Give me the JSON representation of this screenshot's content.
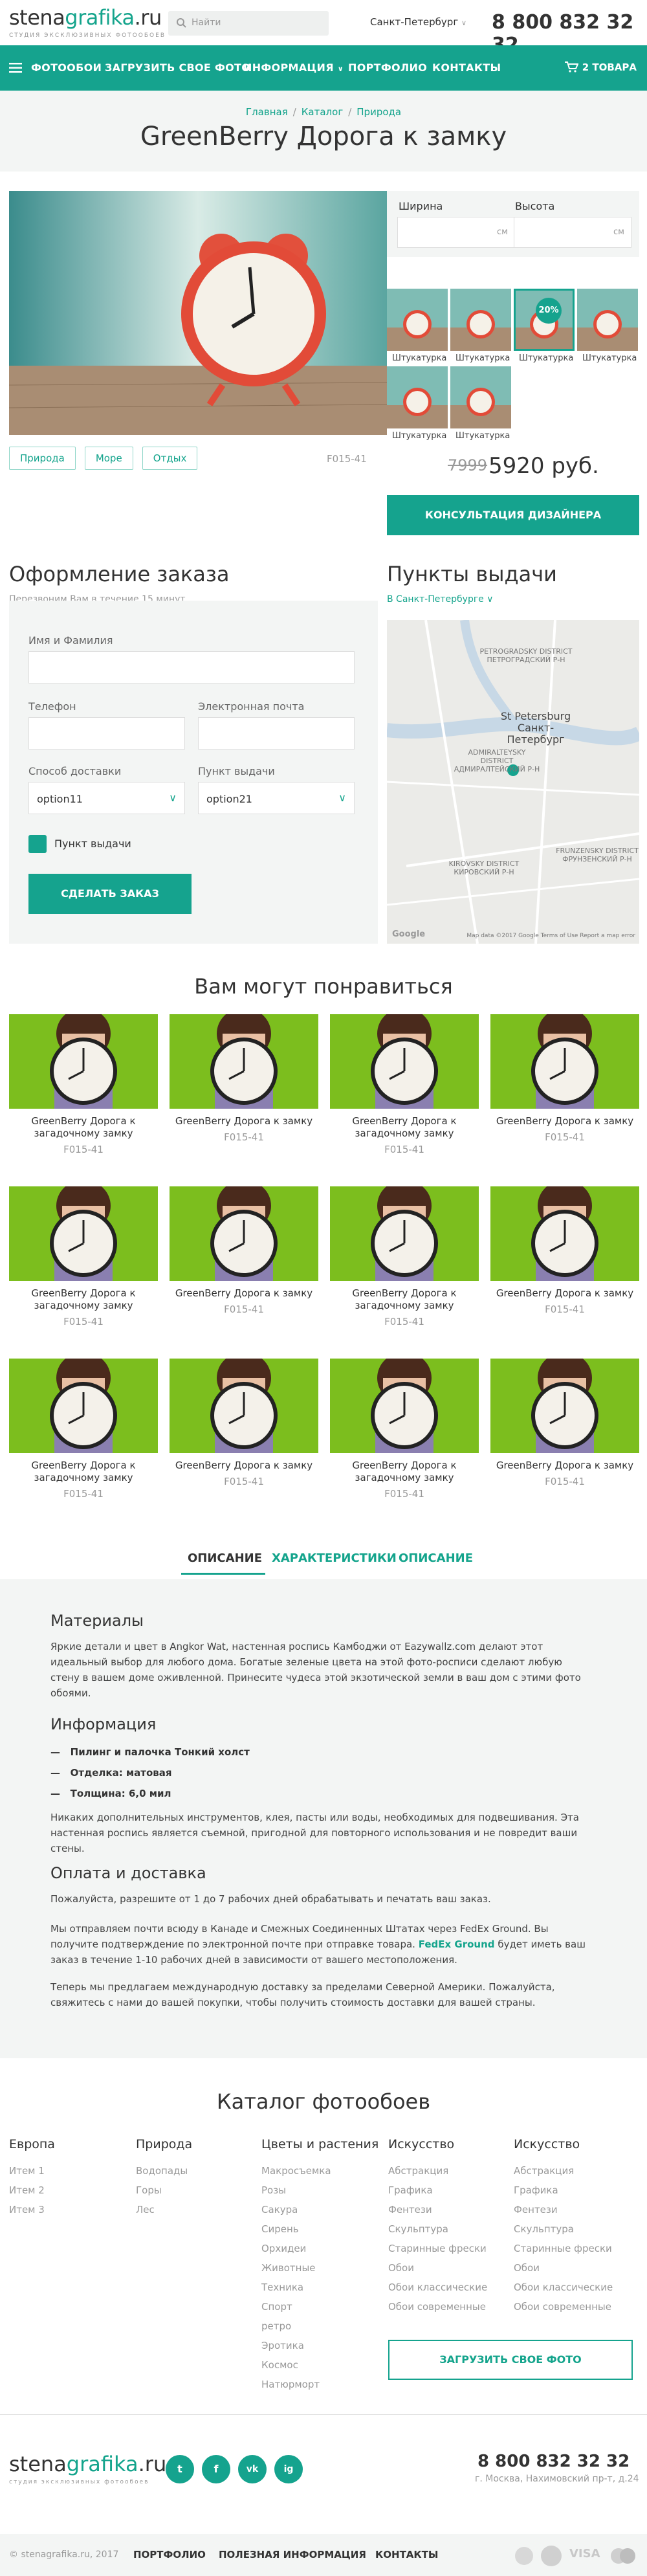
{
  "header": {
    "logo_a": "stena",
    "logo_b": "grafika",
    "logo_c": ".ru",
    "logo_sub": "студия эксклюзивных фотообоев",
    "search_placeholder": "Найти",
    "city": "Санкт-Петербург",
    "phone": "8 800 832 32 32"
  },
  "nav": {
    "items": [
      "ФОТООБОИ",
      "ЗАГРУЗИТЬ СВОЕ ФОТО",
      "ИНФОРМАЦИЯ",
      "ПОРТФОЛИО",
      "КОНТАКТЫ"
    ],
    "cart": "2 ТОВАРА"
  },
  "breadcrumbs": [
    "Главная",
    "Каталог",
    "Природа"
  ],
  "title": "GreenBerry Дорога к замку",
  "product": {
    "tags": [
      "Природа",
      "Море",
      "Отдых"
    ],
    "sku": "F015-41",
    "width_label": "Ширина",
    "height_label": "Высота",
    "unit": "см",
    "swatch_label": "Штукатурка",
    "discount": "20%",
    "old_price": "7999",
    "new_price": "5920 руб.",
    "consult": "КОНСУЛЬТАЦИЯ ДИЗАЙНЕРА"
  },
  "order": {
    "title": "Оформление заказа",
    "subtitle": "Перезвоним Вам в течение 15 минут",
    "name_label": "Имя и Фамилия",
    "phone_label": "Телефон",
    "email_label": "Электронная почта",
    "delivery_label": "Способ доставки",
    "delivery_value": "option11",
    "pickup_label": "Пункт выдачи",
    "pickup_value": "option21",
    "checkbox_label": "Пункт выдачи",
    "submit": "СДЕЛАТЬ ЗАКАЗ"
  },
  "pickup": {
    "title": "Пункты выдачи",
    "city": "В Санкт-Петербурге",
    "map_labels": {
      "petrogradsky": "PETROGRADSKY DISTRICT",
      "petrogradsky_ru": "ПЕТРОГРАДСКИЙ Р-Н",
      "city_en": "St Petersburg",
      "city_ru": "Санкт-Петербург",
      "admiralteysky": "ADMIRALTEYSKY DISTRICT",
      "admiralteysky_ru": "АДМИРАЛТЕЙСКИЙ Р-Н",
      "kirovsky": "KIROVSKY DISTRICT",
      "kirovsky_ru": "КИРОВСКИЙ Р-Н",
      "frunzensky": "FRUNZENSKY DISTRICT",
      "frunzensky_ru": "ФРУНЗЕНСКИЙ Р-Н",
      "google": "Google",
      "attribution": "Map data ©2017 Google   Terms of Use   Report a map error"
    }
  },
  "recommend": {
    "title": "Вам могут понравиться",
    "items": [
      {
        "name": "GreenBerry Дорога к загадочному замку",
        "code": "F015-41"
      },
      {
        "name": "GreenBerry Дорога к замку",
        "code": "F015-41"
      },
      {
        "name": "GreenBerry Дорога к загадочному замку",
        "code": "F015-41"
      },
      {
        "name": "GreenBerry Дорога к замку",
        "code": "F015-41"
      },
      {
        "name": "GreenBerry Дорога к загадочному замку",
        "code": "F015-41"
      },
      {
        "name": "GreenBerry Дорога к замку",
        "code": "F015-41"
      },
      {
        "name": "GreenBerry Дорога к загадочному замку",
        "code": "F015-41"
      },
      {
        "name": "GreenBerry Дорога к замку",
        "code": "F015-41"
      },
      {
        "name": "GreenBerry Дорога к загадочному замку",
        "code": "F015-41"
      },
      {
        "name": "GreenBerry Дорога к замку",
        "code": "F015-41"
      },
      {
        "name": "GreenBerry Дорога к загадочному замку",
        "code": "F015-41"
      },
      {
        "name": "GreenBerry Дорога к замку",
        "code": "F015-41"
      }
    ]
  },
  "tabs": [
    "ОПИСАНИЕ",
    "ХАРАКТЕРИСТИКИ",
    "ОПИСАНИЕ"
  ],
  "description": {
    "materials_title": "Материалы",
    "materials_text": "Яркие детали и цвет в Angkor Wat, настенная роспись Камбоджи от Eazywallz.com делают этот идеальный выбор для любого дома. Богатые зеленые цвета на этой фото-росписи сделают любую стену в вашем доме оживленной. Принесите чудеса этой экзотической земли в ваш дом с этими фото обоями.",
    "info_title": "Информация",
    "info_items": [
      "Пилинг и палочка Тонкий холст",
      "Отделка: матовая",
      "Толщина: 6,0 мил"
    ],
    "info_text": "Никаких дополнительных инструментов, клея, пасты или воды, необходимых для подвешивания. Эта настенная роспись является съемной, пригодной для повторного использования и не повредит ваши стены.",
    "pay_title": "Оплата и доставка",
    "pay_text1": "Пожалуйста, разрешите от 1 до 7 рабочих дней обрабатывать и печатать ваш заказ.",
    "pay_text2a": "Мы отправляем почти всюду в Канаде и Смежных Соединенных Штатах через FedEx Ground. Вы получите подтверждение по электронной почте при отправке товара.",
    "pay_link": "FedEx Ground",
    "pay_text2b": "будет иметь ваш заказ в течение 1-10 рабочих дней в зависимости от вашего местоположения.",
    "pay_text3": "Теперь мы предлагаем международную доставку за пределами Северной Америки. Пожалуйста, свяжитесь с нами до вашей покупки, чтобы получить стоимость доставки для вашей страны."
  },
  "catalog": {
    "title": "Каталог фотообоев",
    "columns": [
      {
        "title": "Европа",
        "items": [
          "Итем 1",
          "Итем 2",
          "Итем 3"
        ]
      },
      {
        "title": "Природа",
        "items": [
          "Водопады",
          "Горы",
          "Лес"
        ]
      },
      {
        "title": "Цветы и растения",
        "items": [
          "Макросъемка",
          "Розы",
          "Сакура",
          "Сирень",
          "Орхидеи",
          "Животные",
          "Техника",
          "Спорт",
          "ретро",
          "Эротика",
          "Космос",
          "Натюрморт"
        ]
      },
      {
        "title": "Искусство",
        "items": [
          "Абстракция",
          "Графика",
          "Фентези",
          "Скульптура",
          "Старинные фрески",
          "Обои",
          "Обои классические",
          "Обои современные"
        ]
      },
      {
        "title": "Искусство",
        "items": [
          "Абстракция",
          "Графика",
          "Фентези",
          "Скульптура",
          "Старинные фрески",
          "Обои",
          "Обои классические",
          "Обои современные"
        ]
      }
    ],
    "upload": "ЗАГРУЗИТЬ СВОЕ ФОТО"
  },
  "footer": {
    "social": [
      "t",
      "f",
      "vk",
      "ig"
    ],
    "phone": "8 800 832 32 32",
    "address": "г. Москва, Нахимовский пр-т, д.24",
    "copyright": "© stenagrafika.ru, 2017",
    "links": [
      "ПОРТФОЛИО",
      "ПОЛЕЗНАЯ ИНФОРМАЦИЯ",
      "КОНТАКТЫ"
    ],
    "payments": [
      "MasterCard",
      "VISA"
    ]
  },
  "colors": {
    "accent": "#15a38e"
  }
}
